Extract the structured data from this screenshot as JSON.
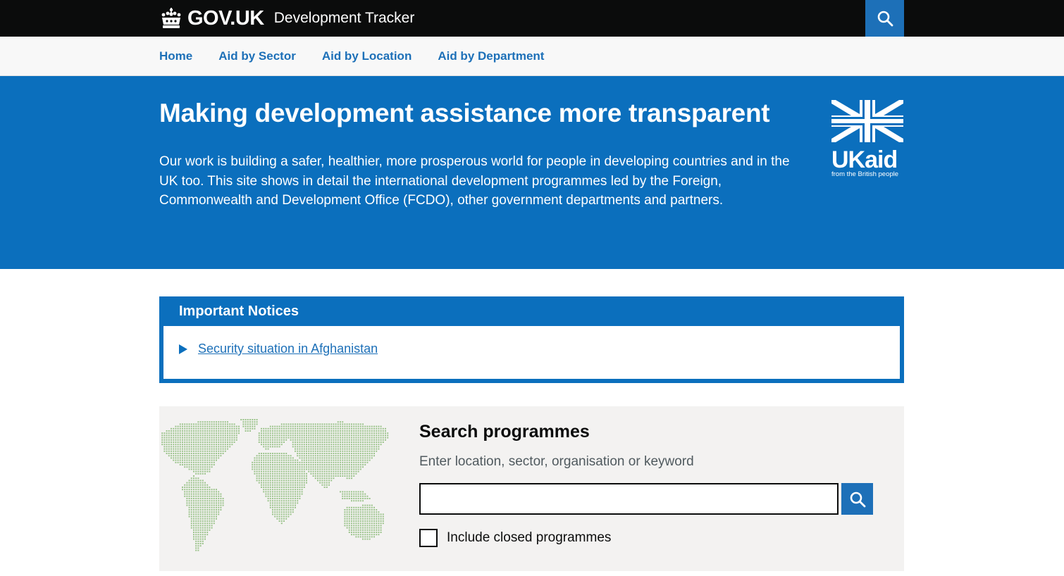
{
  "header": {
    "logo_text": "GOV.UK",
    "service_name": "Development Tracker",
    "search_icon": "search-icon",
    "background": "#0b0c0c",
    "accent": "#1d70b8"
  },
  "nav": {
    "items": [
      {
        "label": "Home"
      },
      {
        "label": "Aid by Sector"
      },
      {
        "label": "Aid by Location"
      },
      {
        "label": "Aid by Department"
      }
    ]
  },
  "hero": {
    "title": "Making development assistance more transparent",
    "text": "Our work is building a safer, healthier, more prosperous world for people in developing countries and in the UK too. This site shows in detail the international development programmes led by the Foreign, Commonwealth and Development Office (FCDO), other government departments and partners.",
    "logo": {
      "brand": "UKaid",
      "tagline": "from the British people"
    },
    "background": "#0b6fbd"
  },
  "notices": {
    "title": "Important Notices",
    "items": [
      {
        "label": "Security situation in Afghanistan"
      }
    ]
  },
  "search": {
    "title": "Search programmes",
    "hint": "Enter location, sector, organisation or keyword",
    "input_value": "",
    "button_icon": "search-icon",
    "checkbox_label": "Include closed programmes",
    "checkbox_checked": false,
    "map_icon": "world-map-icon"
  }
}
